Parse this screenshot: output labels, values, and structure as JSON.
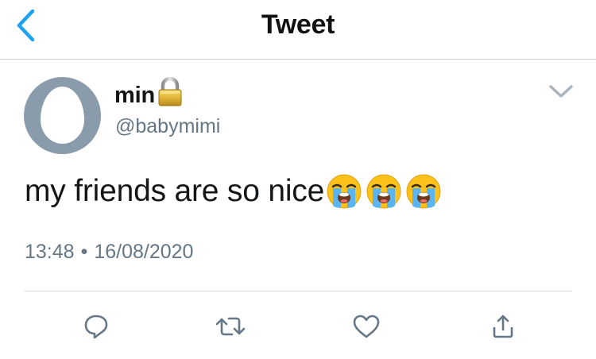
{
  "header": {
    "title": "Tweet",
    "back_icon": "chevron-left-icon",
    "accent_color": "#1da1f2"
  },
  "tweet": {
    "author": {
      "display_name": "min",
      "handle": "@babymimi",
      "protected_icon": "lock-icon",
      "avatar": "default-egg-avatar"
    },
    "text": "my friends are so nice",
    "emojis": [
      "loudly-crying-face",
      "loudly-crying-face",
      "loudly-crying-face"
    ],
    "time": "13:48",
    "separator": "•",
    "date": "16/08/2020"
  },
  "menu_icon": "chevron-down-icon",
  "actions": [
    {
      "icon": "reply-icon"
    },
    {
      "icon": "retweet-icon"
    },
    {
      "icon": "like-icon"
    },
    {
      "icon": "share-icon"
    }
  ],
  "colors": {
    "text": "#14171a",
    "secondary": "#657786",
    "icon_gray": "#657786",
    "divider": "#cfd4d9",
    "avatar_bg": "#8a9bab"
  }
}
